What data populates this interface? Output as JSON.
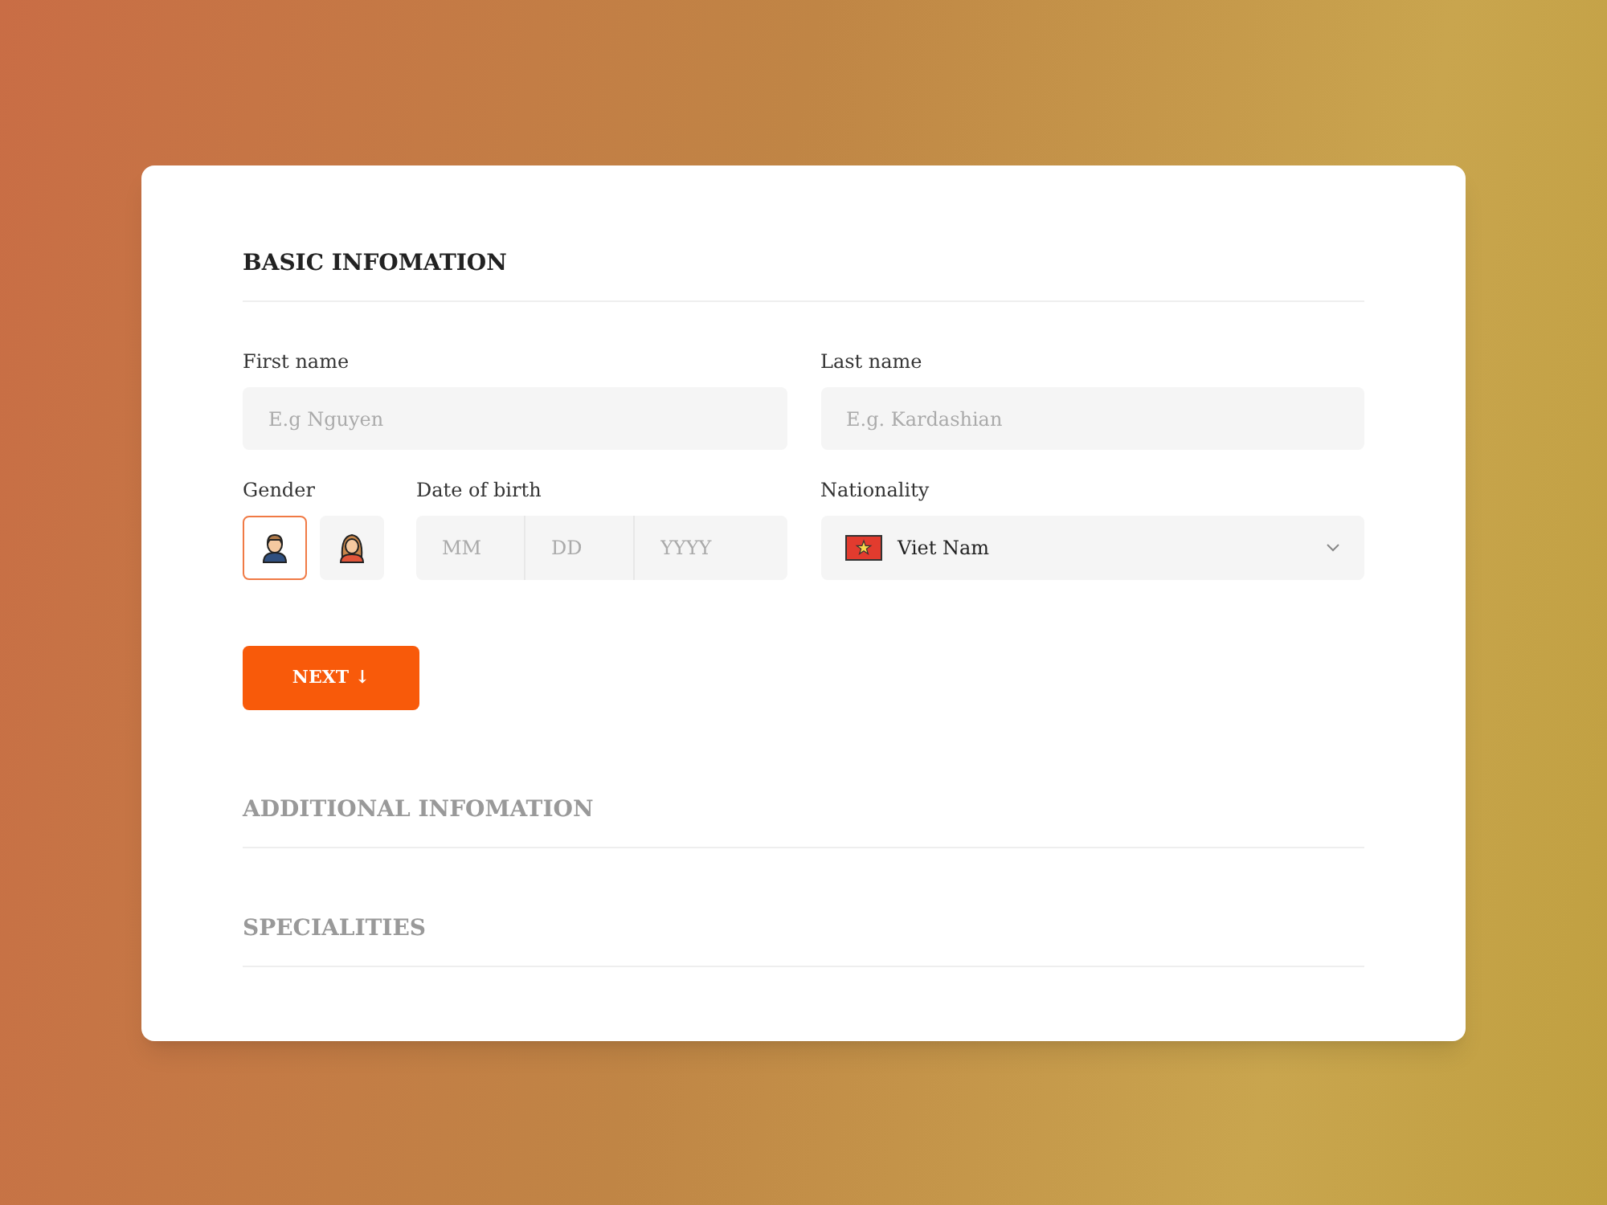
{
  "sections": [
    {
      "title": "BASIC INFOMATION",
      "expanded": true
    },
    {
      "title": "ADDITIONAL INFOMATION",
      "expanded": false
    },
    {
      "title": "SPECIALITIES",
      "expanded": false
    }
  ],
  "first_name": {
    "label": "First name",
    "placeholder": "E.g Nguyen"
  },
  "last_name": {
    "label": "Last name",
    "placeholder": "E.g. Kardashian"
  },
  "gender": {
    "label": "Gender",
    "options": [
      {
        "kind": "male",
        "selected": true
      },
      {
        "kind": "female",
        "selected": false
      }
    ]
  },
  "date_of_birth": {
    "label": "Date of birth",
    "fields": [
      {
        "placeholder": "MM"
      },
      {
        "placeholder": "DD"
      },
      {
        "placeholder": "YYYY"
      }
    ]
  },
  "nationality": {
    "label": "Nationality",
    "value": "Viet Nam"
  },
  "next_button": {
    "label": "NEXT ↓"
  }
}
